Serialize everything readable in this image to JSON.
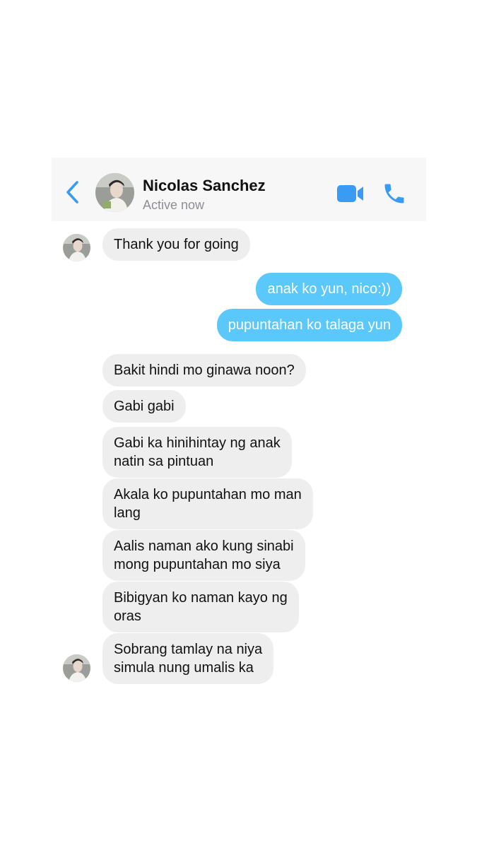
{
  "header": {
    "back_icon": "chevron-left-icon",
    "name": "Nicolas Sanchez",
    "status": "Active now",
    "video_icon": "video-camera-icon",
    "call_icon": "phone-icon",
    "accent_color": "#3a9bf5"
  },
  "messages": [
    {
      "sender": "them",
      "text": "Thank you for going"
    },
    {
      "sender": "me",
      "text": "anak ko yun, nico:))"
    },
    {
      "sender": "me",
      "text": "pupuntahan ko talaga yun"
    },
    {
      "sender": "them",
      "text": "Bakit hindi mo ginawa noon?"
    },
    {
      "sender": "them",
      "text": "Gabi gabi"
    },
    {
      "sender": "them",
      "lines": [
        "Gabi ka hinihintay ng anak",
        "natin sa pintuan"
      ]
    },
    {
      "sender": "them",
      "lines": [
        "Akala ko pupuntahan mo man",
        "lang"
      ]
    },
    {
      "sender": "them",
      "lines": [
        "Aalis naman ako kung sinabi",
        "mong pupuntahan mo siya"
      ]
    },
    {
      "sender": "them",
      "lines": [
        "Bibigyan ko naman kayo ng",
        "oras"
      ]
    },
    {
      "sender": "them",
      "lines": [
        "Sobrang tamlay na niya",
        "simula nung umalis ka"
      ]
    }
  ],
  "colors": {
    "incoming_bubble": "#eeeeee",
    "outgoing_bubble": "#5ac8fa",
    "header_bg": "#f7f7f7"
  }
}
